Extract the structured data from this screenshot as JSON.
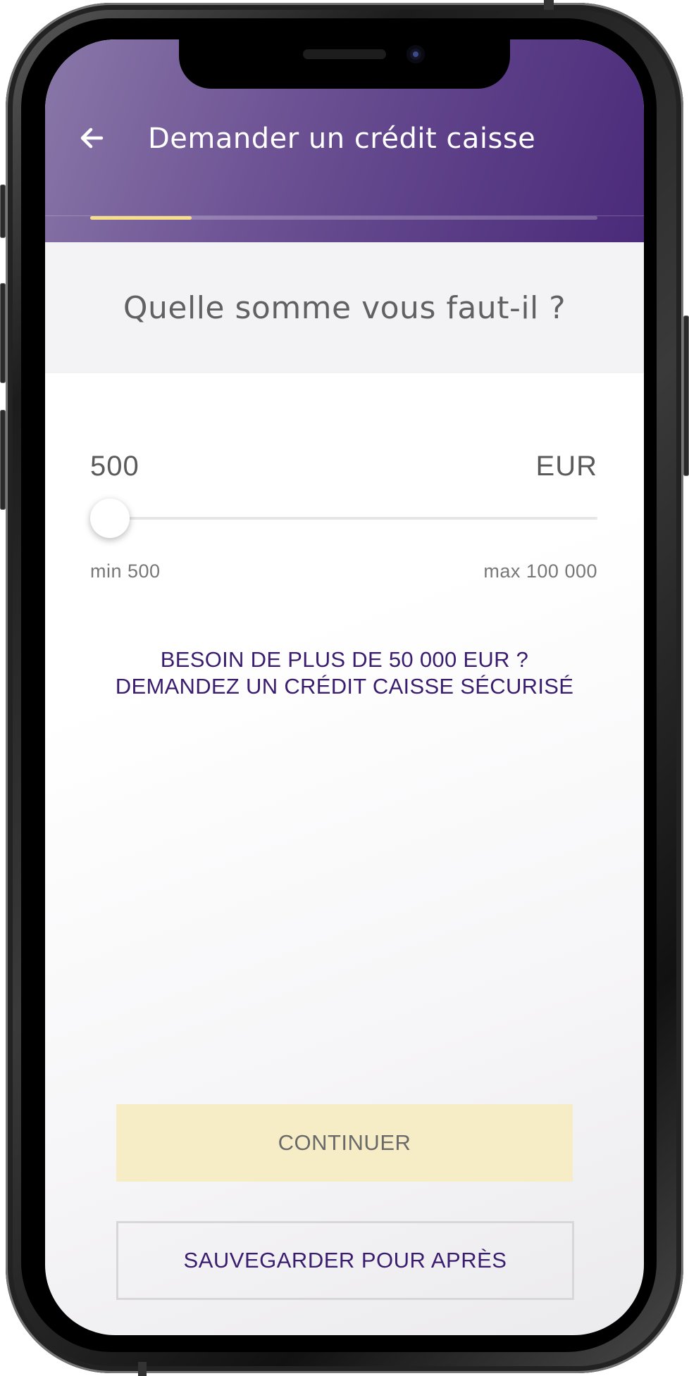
{
  "header": {
    "title": "Demander un crédit caisse",
    "back_icon": "arrow-left-icon",
    "step_progress": 0.2,
    "background_colors": [
      "#8a78a8",
      "#4a2a7a"
    ],
    "progress_color": "#f7df8a"
  },
  "question": "Quelle somme vous faut-il ?",
  "amount": {
    "value": "500",
    "currency": "EUR",
    "slider_position": 0,
    "min_label": "min 500",
    "max_label": "max 100 000"
  },
  "secured_link": {
    "line1": "BESOIN DE PLUS DE 50 000 EUR ?",
    "line2": "DEMANDEZ UN CRÉDIT CAISSE SÉCURISÉ",
    "color": "#3a1d6e"
  },
  "actions": {
    "continue_label": "CONTINUER",
    "save_label": "SAUVEGARDER POUR APRÈS",
    "continue_color": "#f6ecc5"
  }
}
